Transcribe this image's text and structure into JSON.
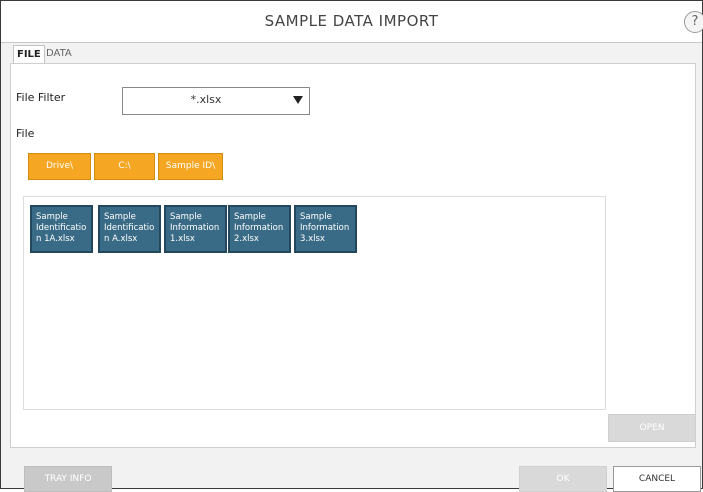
{
  "window": {
    "title": "SAMPLE DATA IMPORT",
    "help_label": "?"
  },
  "tabs": [
    {
      "label": "FILE",
      "active": true
    },
    {
      "label": "DATA",
      "active": false
    }
  ],
  "file_filter": {
    "label": "File Filter",
    "value": "*.xlsx"
  },
  "file_section": {
    "label": "File",
    "breadcrumbs": [
      "Drive\\",
      "C:\\",
      "Sample ID\\"
    ],
    "files": [
      "Sample Identificatio n 1A.xlsx",
      "Sample Identificatio n A.xlsx",
      "Sample Information 1.xlsx",
      "Sample Information 2.xlsx",
      "Sample Information 3.xlsx"
    ]
  },
  "buttons": {
    "open": "OPEN",
    "tray_info": "TRAY INFO",
    "ok": "OK",
    "cancel": "CANCEL"
  },
  "colors": {
    "breadcrumb": "#f5a623",
    "file_tile": "#3a6b86",
    "disabled_button": "#d9d9d9"
  }
}
